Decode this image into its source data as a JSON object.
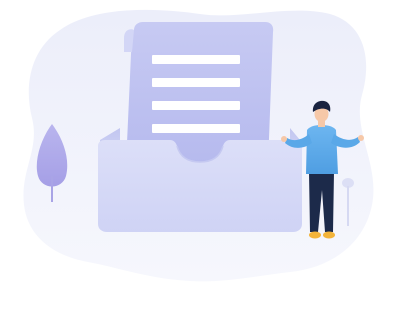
{
  "illustration": {
    "icons": [
      "document-tray-icon",
      "person-icon",
      "tree-icon",
      "plant-icon"
    ],
    "colors": {
      "background": "#ffffff",
      "blob": "#eef0fa",
      "tray": "#d9dcf7",
      "paper": "#c9ccf4",
      "paper_lines": "#ffffff",
      "person_shirt": "#5aa8e8",
      "person_pants": "#1c2a4a",
      "person_hair": "#1a2340",
      "person_shoes": "#f3b43a"
    }
  }
}
